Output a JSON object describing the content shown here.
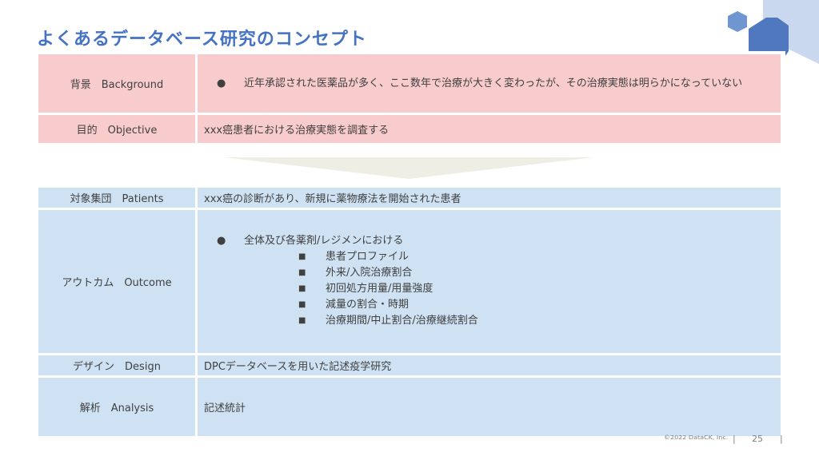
{
  "slide": {
    "title": "よくあるデータベース研究のコンセプト",
    "page_number": "25",
    "copyright": "©2022 DataCK, Inc.",
    "footer_separator": "|"
  },
  "colors": {
    "title": "#4472c4",
    "pink_cell": "#f8cbcc",
    "blue_cell": "#cfe2f3",
    "arrow": "#eeeee4"
  },
  "top_table": {
    "rows": [
      {
        "label": "背景　Background",
        "bullet": "●",
        "text": "近年承認された医薬品が多く、ここ数年で治療が大きく変わったが、その治療実態は明らかになっていない"
      },
      {
        "label": "目的　Objective",
        "text": "xxx癌患者における治療実態を調査する"
      }
    ]
  },
  "bottom_table": {
    "rows": [
      {
        "label": "対象集団　Patients",
        "text": "xxx癌の診断があり、新規に薬物療法を開始された患者"
      },
      {
        "label": "アウトカム　Outcome",
        "bullet": "●",
        "text": "全体及び各薬剤/レジメンにおける",
        "sub_bullet": "■",
        "sub_items": [
          "患者プロファイル",
          "外来/入院治療割合",
          "初回処方用量/用量強度",
          "減量の割合・時期",
          "治療期間/中止割合/治療継続割合"
        ]
      },
      {
        "label": "デザイン　Design",
        "text": "DPCデータベースを用いた記述疫学研究"
      },
      {
        "label": "解析　Analysis",
        "text": "記述統計"
      }
    ]
  }
}
